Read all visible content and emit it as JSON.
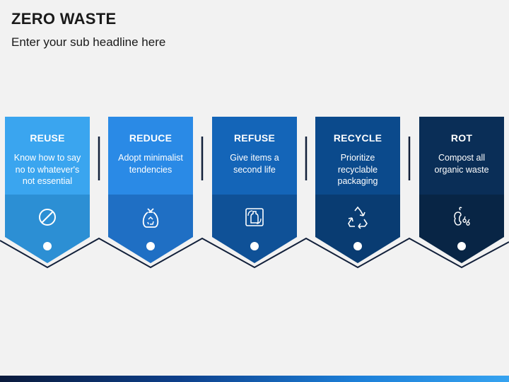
{
  "header": {
    "title": "ZERO WASTE",
    "subtitle": "Enter your sub headline here"
  },
  "steps": [
    {
      "title": "REUSE",
      "description": "Know how to say no to whatever's not essential",
      "icon": "prohibited-icon",
      "top_color": "#3aa5ef",
      "bottom_color": "#2c8fd4"
    },
    {
      "title": "REDUCE",
      "description": "Adopt minimalist tendencies",
      "icon": "waste-bag-icon",
      "top_color": "#2a8ae6",
      "bottom_color": "#1f6fc4"
    },
    {
      "title": "REFUSE",
      "description": "Give items a second life",
      "icon": "reuse-bottle-icon",
      "top_color": "#1465b8",
      "bottom_color": "#0f5197"
    },
    {
      "title": "RECYCLE",
      "description": "Prioritize recyclable packaging",
      "icon": "recycle-icon",
      "top_color": "#0b4a8c",
      "bottom_color": "#093c72"
    },
    {
      "title": "ROT",
      "description": "Compost all organic waste",
      "icon": "compost-icon",
      "top_color": "#0a2e57",
      "bottom_color": "#082545"
    }
  ]
}
